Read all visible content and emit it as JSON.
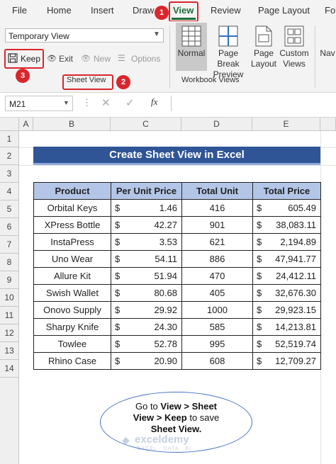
{
  "menu": [
    "File",
    "Home",
    "Insert",
    "Draw",
    "View",
    "Review",
    "Page Layout",
    "Fo"
  ],
  "ribbon": {
    "sheet_view_select": "Temporary View",
    "keep_label": "Keep",
    "exit_label": "Exit",
    "new_label": "New",
    "options_label": "Options",
    "sheet_view_group": "Sheet View",
    "normal_label": "Normal",
    "page_break_label_1": "Page Break",
    "page_break_label_2": "Preview",
    "page_label_1": "Page",
    "page_label_2": "Layout",
    "custom_label_1": "Custom",
    "custom_label_2": "Views",
    "nav_label": "Nav",
    "workbook_views_group": "Workbook Views"
  },
  "badges": [
    "1",
    "2",
    "3"
  ],
  "formula_bar": {
    "name_box": "M21",
    "fx": "fx",
    "formula": ""
  },
  "columns": [
    "A",
    "B",
    "C",
    "D",
    "E"
  ],
  "rows": [
    "1",
    "2",
    "3",
    "4",
    "5",
    "6",
    "7",
    "8",
    "9",
    "10",
    "11",
    "12",
    "13",
    "14"
  ],
  "title": "Create Sheet View in Excel",
  "table": {
    "headers": [
      "Product",
      "Per Unit Price",
      "Total Unit",
      "Total Price"
    ],
    "currency": "$",
    "rows": [
      [
        "Orbital Keys",
        "1.46",
        "416",
        "605.49"
      ],
      [
        "XPress Bottle",
        "42.27",
        "901",
        "38,083.11"
      ],
      [
        "InstaPress",
        "3.53",
        "621",
        "2,194.89"
      ],
      [
        "Uno Wear",
        "54.11",
        "886",
        "47,941.77"
      ],
      [
        "Allure Kit",
        "51.94",
        "470",
        "24,412.11"
      ],
      [
        "Swish Wallet",
        "80.68",
        "405",
        "32,676.30"
      ],
      [
        "Onovo Supply",
        "29.92",
        "1000",
        "29,923.15"
      ],
      [
        "Sharpy Knife",
        "24.30",
        "585",
        "14,213.81"
      ],
      [
        "Towlee",
        "52.78",
        "995",
        "52,519.74"
      ],
      [
        "Rhino Case",
        "20.90",
        "608",
        "12,709.27"
      ]
    ]
  },
  "callout": {
    "line1_pre": "Go to ",
    "line1_bold": "View > Sheet",
    "line2_bold": "View > Keep",
    "line2_post": " to save",
    "line3_bold": "Sheet View."
  },
  "watermark": {
    "brand": "exceldemy",
    "tagline": "EXCEL · DATA · BI"
  },
  "colors": {
    "accent_red": "#d9262c",
    "title_bar": "#2f5597",
    "header_fill": "#b4c6e7",
    "callout_border": "#4472c4"
  }
}
